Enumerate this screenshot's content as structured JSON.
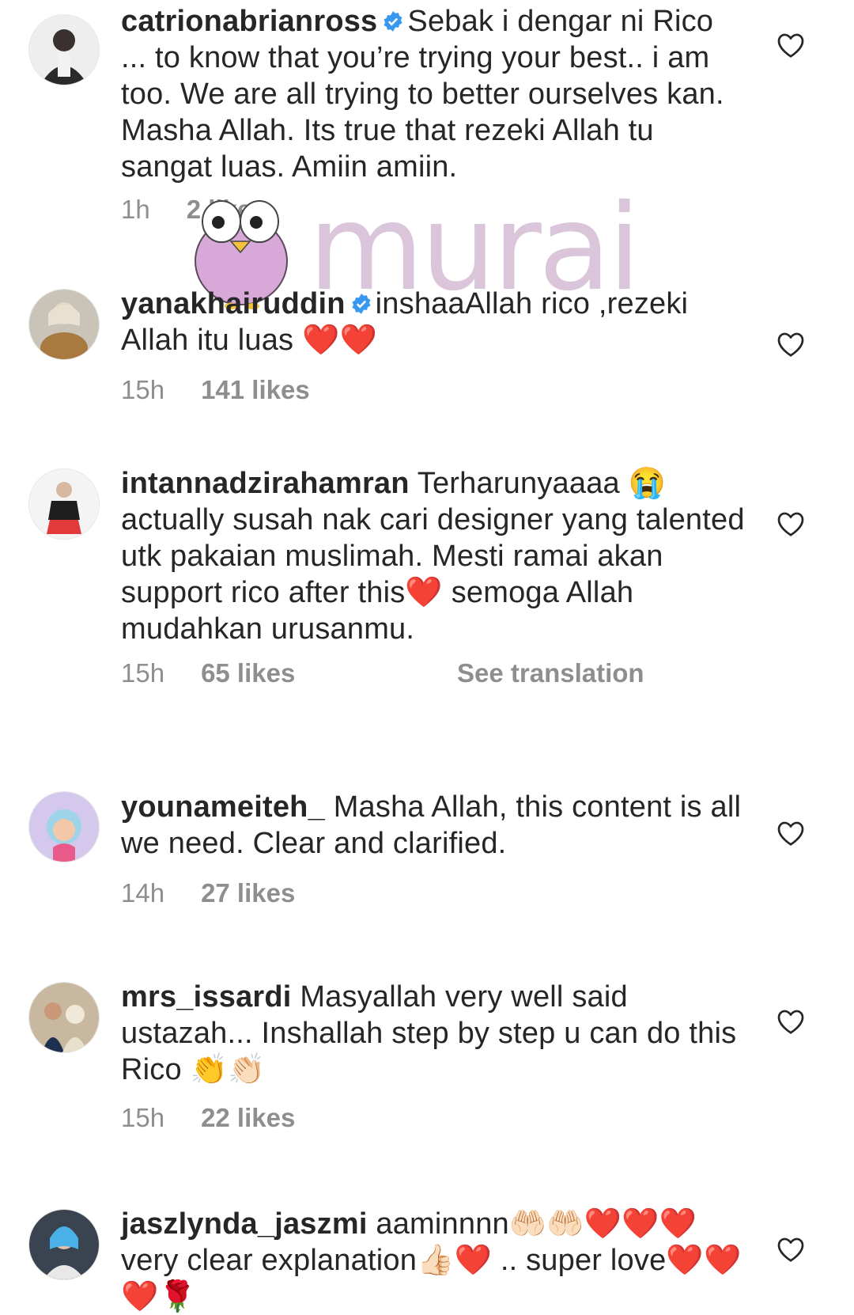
{
  "comments": [
    {
      "username": "catrionabrianross",
      "verified": true,
      "text": "Sebak i dengar ni Rico ... to know that you’re trying your best.. i am too. We are all trying to better ourselves kan. Masha Allah. Its true that rezeki Allah tu sangat luas. Amiin amiin.",
      "time": "1h",
      "likes": "2 likes"
    },
    {
      "username": "yanakhairuddin",
      "verified": true,
      "text": "inshaaAllah rico ,rezeki Allah itu luas ❤️❤️",
      "time": "15h",
      "likes": "141 likes"
    },
    {
      "username": "intannadzirahamran",
      "verified": false,
      "text": "Terharunyaaaa 😭 actually susah nak cari designer yang talented utk pakaian muslimah. Mesti ramai akan support rico after this❤️ semoga Allah mudahkan urusanmu.",
      "time": "15h",
      "likes": "65 likes",
      "translate": "See translation"
    },
    {
      "username": "younameiteh_",
      "verified": false,
      "text": "Masha Allah, this content is all we need. Clear and clarified.",
      "time": "14h",
      "likes": "27 likes"
    },
    {
      "username": "mrs_issardi",
      "verified": false,
      "text": "Masyallah very well said ustazah... Inshallah step by step u can do this Rico 👏👏🏻",
      "time": "15h",
      "likes": "22 likes"
    },
    {
      "username": "jaszlynda_jaszmi",
      "verified": false,
      "text": "aaminnnn🤲🏻🤲🏻❤️❤️❤️ very clear explanation👍🏻❤️ .. super love❤️❤️❤️🌹",
      "time": "",
      "likes": ""
    }
  ],
  "watermark": {
    "text": "murai"
  },
  "icons": {
    "like": "heart-outline-icon",
    "verified": "verified-badge-icon"
  },
  "colors": {
    "text": "#262626",
    "meta": "#8e8e8e",
    "verified": "#3897f0",
    "watermark": "#c89bc8"
  }
}
